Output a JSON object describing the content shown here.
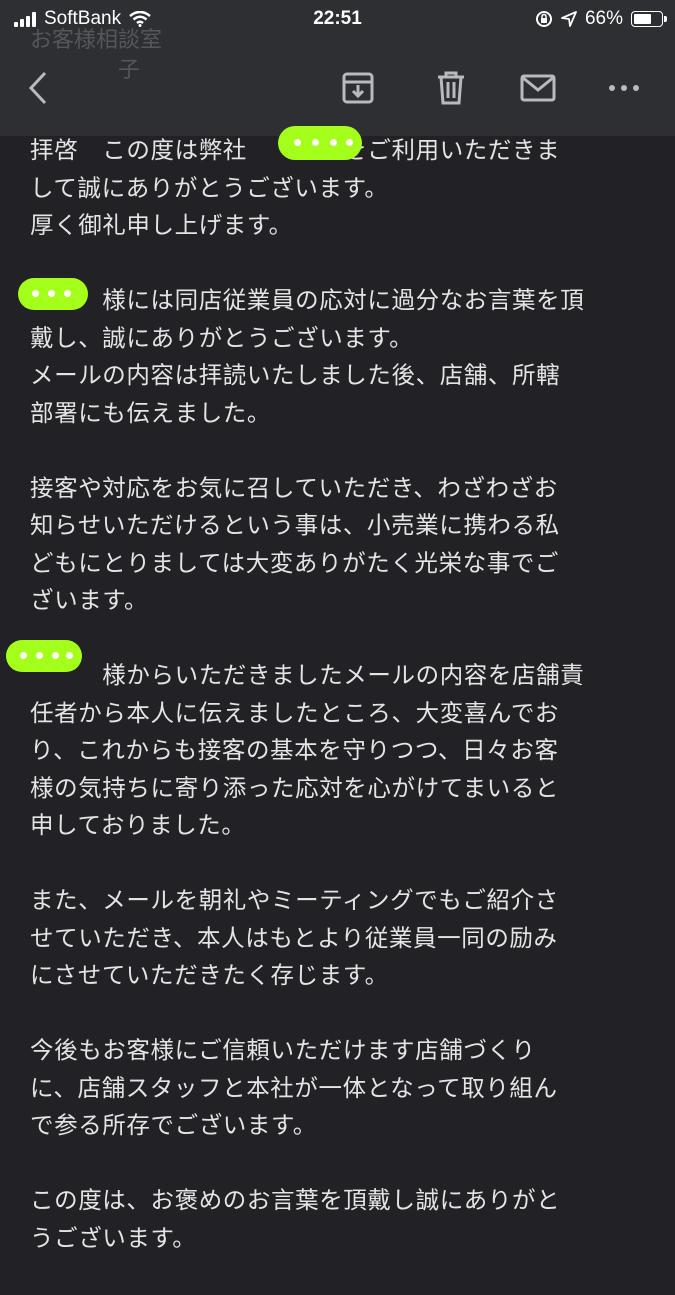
{
  "status_bar": {
    "carrier": "SoftBank",
    "time": "22:51",
    "battery": "66%"
  },
  "toolbar": {
    "back_icon": "chevron-left-icon",
    "archive_icon": "archive-icon",
    "delete_icon": "trash-icon",
    "mail_icon": "mail-icon",
    "more_icon": "more-icon"
  },
  "header_ghost": {
    "line1": "お客様相談室",
    "line2": "　　　　子"
  },
  "mail": {
    "paragraphs": [
      [
        "拝啓　この度は弊社　　　店をご利用いただきま",
        "して誠にありがとうございます。",
        "厚く御礼申し上げます。"
      ],
      [
        "　　　様には同店従業員の応対に過分なお言葉を頂",
        "戴し、誠にありがとうございます。",
        "メールの内容は拝読いたしました後、店舗、所轄",
        "部署にも伝えました。"
      ],
      [
        "接客や対応をお気に召していただき、わざわざお",
        "知らせいただけるという事は、小売業に携わる私",
        "どもにとりましては大変ありがたく光栄な事でご",
        "ざいます。"
      ],
      [
        "　　　様からいただきましたメールの内容を店舗責",
        "任者から本人に伝えましたところ、大変喜んでお",
        "り、これからも接客の基本を守りつつ、日々お客",
        "様の気持ちに寄り添った応対を心がけてまいると",
        "申しておりました。"
      ],
      [
        "また、メールを朝礼やミーティングでもご紹介さ",
        "せていただき、本人はもとより従業員一同の励み",
        "にさせていただきたく存じます。"
      ],
      [
        "今後もお客様にご信頼いただけます店舗づくり",
        "に、店舗スタッフと本社が一体となって取り組ん",
        "で参る所存でございます。"
      ],
      [
        "この度は、お褒めのお言葉を頂戴し誠にありがと",
        "うございます。"
      ]
    ]
  },
  "colors": {
    "background": "#222226",
    "toolbar": "#2e2f33",
    "text": "#e4e4e4",
    "redaction": "#a4ff1a"
  }
}
